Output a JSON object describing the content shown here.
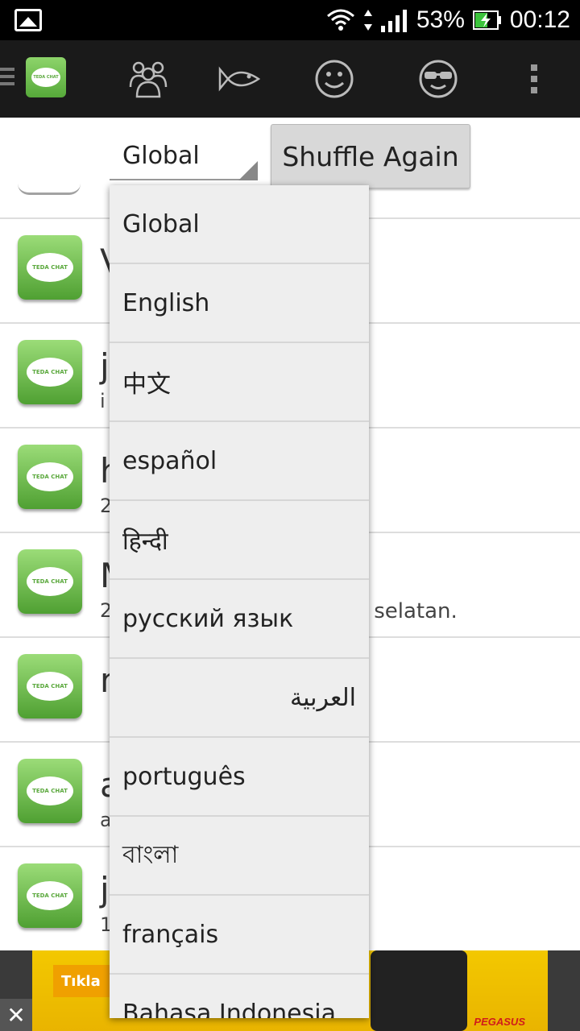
{
  "status_bar": {
    "battery": "53%",
    "time": "00:12"
  },
  "app": {
    "logo_text": "TEDA CHAT"
  },
  "toolbar": {
    "spinner_value": "Global",
    "shuffle_label": "Shuffle Again"
  },
  "list": {
    "rows": [
      {
        "name": "V",
        "sub": "",
        "sub_tail": ""
      },
      {
        "name": "j",
        "sub": "i",
        "sub_tail": ""
      },
      {
        "name": "h",
        "sub": "2",
        "sub_tail": ""
      },
      {
        "name": "M",
        "sub": "2",
        "sub_tail": "a selatan."
      },
      {
        "name": "n",
        "sub": "",
        "sub_tail": ""
      },
      {
        "name": "a",
        "sub": "a",
        "sub_tail": ""
      },
      {
        "name": "j",
        "sub": "1",
        "sub_tail": ""
      }
    ]
  },
  "dropdown": {
    "options": [
      "Global",
      "English",
      "中文",
      "español",
      "हिन्दी",
      "русский язык",
      "العربية",
      "português",
      "বাংলা",
      "français",
      "Bahasa Indonesia"
    ]
  },
  "ad": {
    "cta": "Tıkla",
    "brand": "PEGASUS"
  },
  "colors": {
    "action_bar": "#1a1a1a",
    "app_green": "#5aa83c",
    "dropdown_bg": "#eeeeee"
  }
}
